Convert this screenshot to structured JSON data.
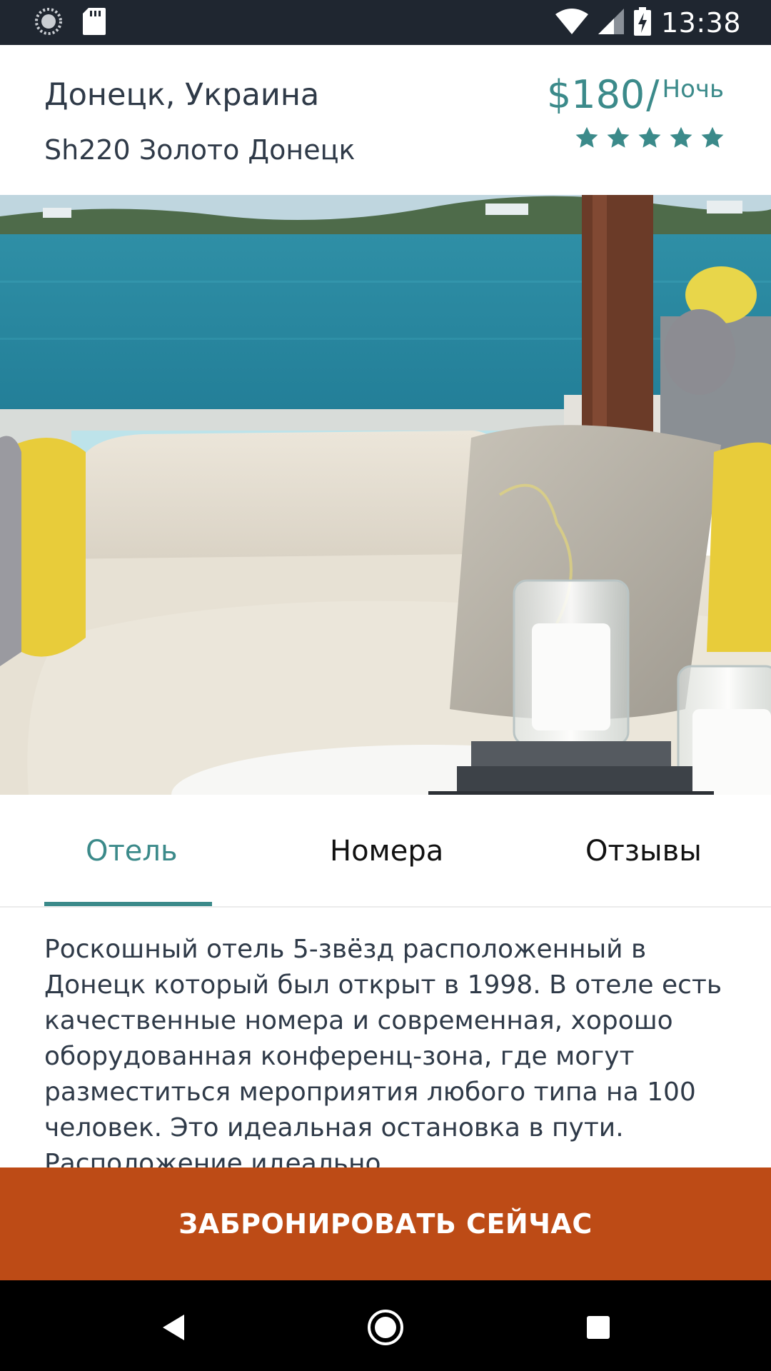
{
  "status_bar": {
    "time": "13:38",
    "icons": [
      "loading-icon",
      "sd-card-icon",
      "wifi-icon",
      "signal-icon",
      "battery-charging-icon"
    ]
  },
  "header": {
    "city": "Донецк, Украина",
    "hotel_name": "Sh220 Золото Донецк",
    "price": "$180",
    "price_separator": "/",
    "price_unit": "Ночь",
    "star_rating": 5,
    "accent_color": "#3b8a8a"
  },
  "hero_image": {
    "subject": "terrace-sofa-sea-view"
  },
  "tabs": [
    {
      "label": "Отель",
      "active": true
    },
    {
      "label": "Номера",
      "active": false
    },
    {
      "label": "Отзывы",
      "active": false
    }
  ],
  "description": "Роскошный отель 5-звёзд расположенный в Донецк который был открыт в 1998. В отеле есть качественные номера и современная, хорошо оборудованная конференц-зона, где могут разместиться мероприятия любого типа на 100 человек. Это идеальная остановка в пути. Расположение идеально",
  "book_button": {
    "label": "ЗАБРОНИРОВАТЬ СЕЙЧАС",
    "color": "#bd4b16"
  },
  "navigation_bar": {
    "icons": [
      "back-icon",
      "home-icon",
      "recents-icon"
    ]
  }
}
